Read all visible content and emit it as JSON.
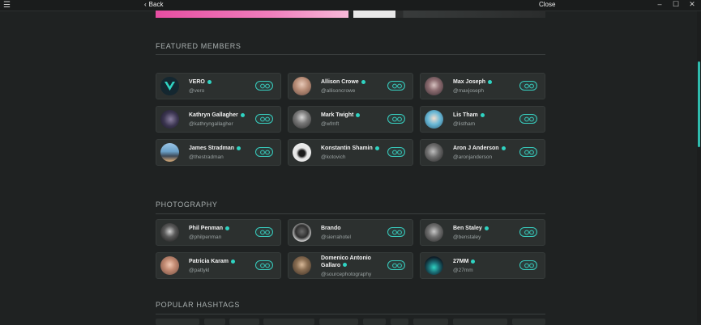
{
  "titlebar": {
    "back_label": "Back",
    "close_label": "Close",
    "menu_icon": "hamburger-icon"
  },
  "sections": {
    "featured": "FEATURED MEMBERS",
    "photography": "PHOTOGRAPHY",
    "hashtags": "POPULAR HASHTAGS"
  },
  "featured_members": [
    {
      "name": "VERO",
      "handle": "@vero"
    },
    {
      "name": "Allison Crowe",
      "handle": "@allisoncrowe"
    },
    {
      "name": "Max Joseph",
      "handle": "@maxjoseph"
    },
    {
      "name": "Kathryn Gallagher",
      "handle": "@kathryngallagher"
    },
    {
      "name": "Mark Twight",
      "handle": "@wfmft"
    },
    {
      "name": "Lis Tham",
      "handle": "@listham"
    },
    {
      "name": "James Stradman",
      "handle": "@thestradman"
    },
    {
      "name": "Konstantin Shamin",
      "handle": "@kotovich"
    },
    {
      "name": "Aron J Anderson",
      "handle": "@aronjanderson"
    }
  ],
  "photography_members": [
    {
      "name": "Phil Penman",
      "handle": "@philpenman"
    },
    {
      "name": "Brando",
      "handle": "@sierrahotel"
    },
    {
      "name": "Ben Staley",
      "handle": "@benstaley"
    },
    {
      "name": "Patricia Karam",
      "handle": "@pattykl"
    },
    {
      "name": "Domenico Antonio Gallaro",
      "handle": "@sourcephotography"
    },
    {
      "name": "27MM",
      "handle": "@27mm"
    }
  ],
  "colors": {
    "accent": "#2fd3c2",
    "background": "#1f2222",
    "card": "#2c302f"
  }
}
